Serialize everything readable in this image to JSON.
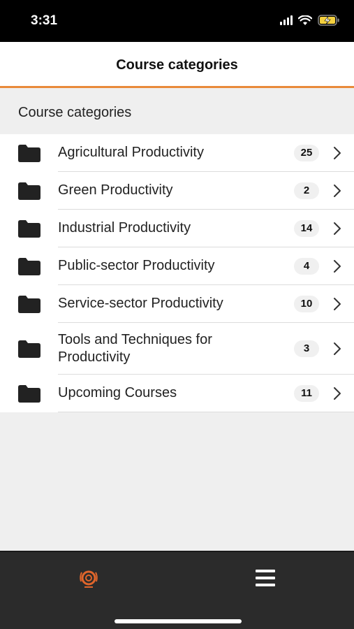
{
  "status_bar": {
    "time": "3:31"
  },
  "nav": {
    "title": "Course categories"
  },
  "section": {
    "title": "Course categories"
  },
  "categories": [
    {
      "label": "Agricultural Productivity",
      "count": "25"
    },
    {
      "label": "Green Productivity",
      "count": "2"
    },
    {
      "label": "Industrial Productivity",
      "count": "14"
    },
    {
      "label": "Public-sector Productivity",
      "count": "4"
    },
    {
      "label": "Service-sector Productivity",
      "count": "10"
    },
    {
      "label": "Tools and Techniques for Productivity",
      "count": "3"
    },
    {
      "label": "Upcoming Courses",
      "count": "11"
    }
  ],
  "colors": {
    "accent": "#e98a3a",
    "tab_bar": "#2b2b2b",
    "folder": "#222222"
  },
  "icons": {
    "folder": "folder-icon",
    "chevron": "chevron-right-icon",
    "logo": "apo-logo-icon",
    "menu": "menu-icon"
  }
}
